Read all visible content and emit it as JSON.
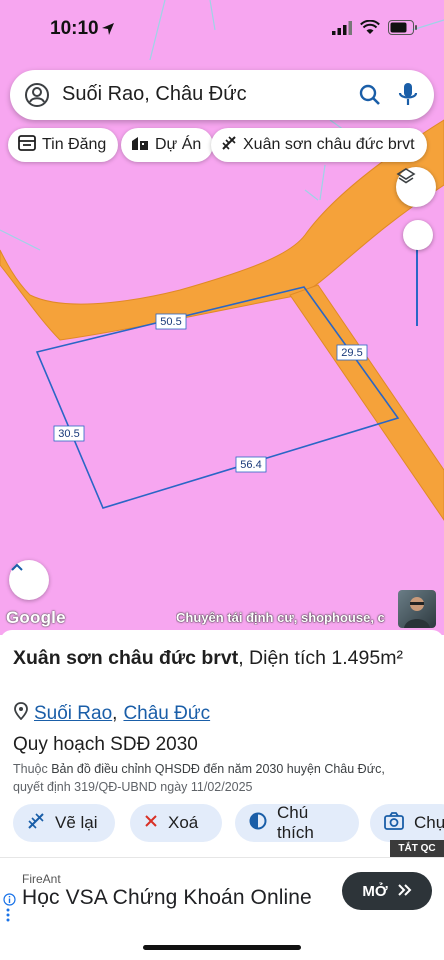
{
  "status": {
    "time": "10:10"
  },
  "search": {
    "value": "Suối Rao, Châu Đức"
  },
  "chips": [
    {
      "label": "Tin Đăng"
    },
    {
      "label": "Dự Án"
    },
    {
      "label": "Xuân sơn châu đức brvt"
    }
  ],
  "map": {
    "edges": {
      "top": "50.5",
      "right": "29.5",
      "left": "30.5",
      "bottom": "56.4"
    },
    "logo": "Google",
    "attribution": "Chuyên tái định cư, shophouse, c"
  },
  "place": {
    "name": "Xuân sơn châu đức brvt",
    "area_text": ", Diện tích 1.495m²",
    "loc1": "Suối Rao",
    "sep": ",",
    "loc2": "Châu Đức",
    "plan_title": "Quy hoạch SDĐ 2030",
    "plan_prefix": "Thuộc ",
    "plan_body": "Bản đồ điều chỉnh QHSDĐ đến năm 2030 huyện Châu Đức,",
    "plan_line2": "quyết định 319/QĐ-UBND ngày 11/02/2025"
  },
  "actions": [
    {
      "label": "Vẽ lại"
    },
    {
      "label": "Xoá"
    },
    {
      "label": "Chú thích"
    },
    {
      "label": "Chụp"
    }
  ],
  "ad": {
    "close_label": "TẮT QC",
    "brand": "FireAnt",
    "title": "Học VSA Chứng Khoán Online",
    "cta": "MỞ"
  },
  "colors": {
    "map_bg": "#f7a6f0",
    "road": "#f5a23a",
    "plot_line": "#2a66c6",
    "chip_bg": "#e3ecfa"
  }
}
